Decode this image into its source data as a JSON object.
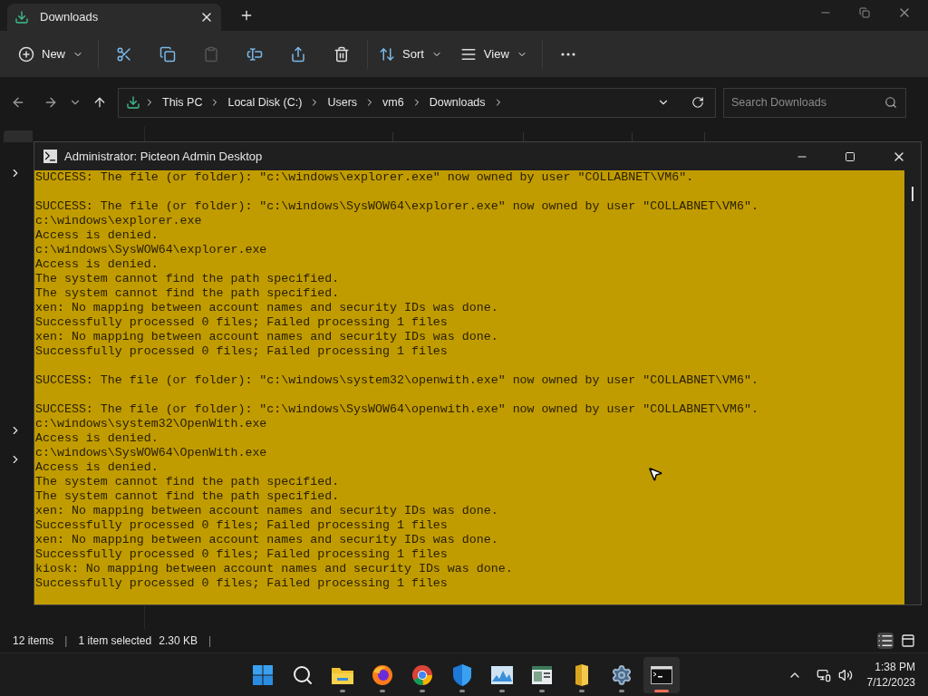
{
  "explorer": {
    "tab": {
      "title": "Downloads"
    },
    "toolbar": [
      {
        "kind": "new",
        "label": "New",
        "disabled": false
      },
      {
        "kind": "cut",
        "disabled": false
      },
      {
        "kind": "copy",
        "disabled": false
      },
      {
        "kind": "paste",
        "disabled": true
      },
      {
        "kind": "rename",
        "disabled": false
      },
      {
        "kind": "share",
        "disabled": false
      },
      {
        "kind": "delete",
        "disabled": false
      },
      {
        "kind": "sort",
        "label": "Sort",
        "disabled": false
      },
      {
        "kind": "view",
        "label": "View",
        "disabled": false
      },
      {
        "kind": "more",
        "disabled": false
      }
    ],
    "breadcrumb": [
      "This PC",
      "Local Disk (C:)",
      "Users",
      "vm6",
      "Downloads"
    ],
    "search": {
      "placeholder": "Search Downloads"
    },
    "status_bar": [
      {
        "kind": "text",
        "text": "12 items"
      },
      {
        "kind": "separator",
        "text": "|"
      },
      {
        "kind": "text",
        "text": "1 item selected"
      },
      {
        "kind": "text",
        "text": "2.30 KB"
      },
      {
        "kind": "separator",
        "text": "|"
      }
    ]
  },
  "console": {
    "title": "Administrator:  Picteon Admin Desktop",
    "blocks": [
      [
        "SUCCESS: The file (or folder): \"c:\\windows\\explorer.exe\" now owned by user \"COLLABNET\\VM6\"."
      ],
      [
        "SUCCESS: The file (or folder): \"c:\\windows\\SysWOW64\\explorer.exe\" now owned by user \"COLLABNET\\VM6\".",
        "c:\\windows\\explorer.exe",
        "Access is denied.",
        "c:\\windows\\SysWOW64\\explorer.exe",
        "Access is denied.",
        "The system cannot find the path specified.",
        "The system cannot find the path specified.",
        "xen: No mapping between account names and security IDs was done.",
        "Successfully processed 0 files; Failed processing 1 files",
        "xen: No mapping between account names and security IDs was done.",
        "Successfully processed 0 files; Failed processing 1 files"
      ],
      [
        "SUCCESS: The file (or folder): \"c:\\windows\\system32\\openwith.exe\" now owned by user \"COLLABNET\\VM6\"."
      ],
      [
        "SUCCESS: The file (or folder): \"c:\\windows\\SysWOW64\\openwith.exe\" now owned by user \"COLLABNET\\VM6\".",
        "c:\\windows\\system32\\OpenWith.exe",
        "Access is denied.",
        "c:\\windows\\SysWOW64\\OpenWith.exe",
        "Access is denied.",
        "The system cannot find the path specified.",
        "The system cannot find the path specified.",
        "xen: No mapping between account names and security IDs was done.",
        "Successfully processed 0 files; Failed processing 1 files",
        "xen: No mapping between account names and security IDs was done.",
        "Successfully processed 0 files; Failed processing 1 files",
        "kiosk: No mapping between account names and security IDs was done.",
        "Successfully processed 0 files; Failed processing 1 files"
      ]
    ]
  },
  "taskbar": {
    "apps": [
      {
        "kind": "start",
        "running": false,
        "active": false
      },
      {
        "kind": "search",
        "running": false,
        "active": false
      },
      {
        "kind": "folder",
        "running": true,
        "active": false
      },
      {
        "kind": "browser-orange",
        "running": true,
        "active": false
      },
      {
        "kind": "browser-round",
        "running": true,
        "active": false
      },
      {
        "kind": "shield",
        "running": true,
        "active": false
      },
      {
        "kind": "monitor",
        "running": true,
        "active": false
      },
      {
        "kind": "window",
        "running": true,
        "active": false
      },
      {
        "kind": "files",
        "running": true,
        "active": false
      },
      {
        "kind": "gear",
        "running": true,
        "active": false
      },
      {
        "kind": "terminal",
        "running": true,
        "active": true
      }
    ],
    "time": "1:38 PM",
    "date": "7/12/2023"
  }
}
